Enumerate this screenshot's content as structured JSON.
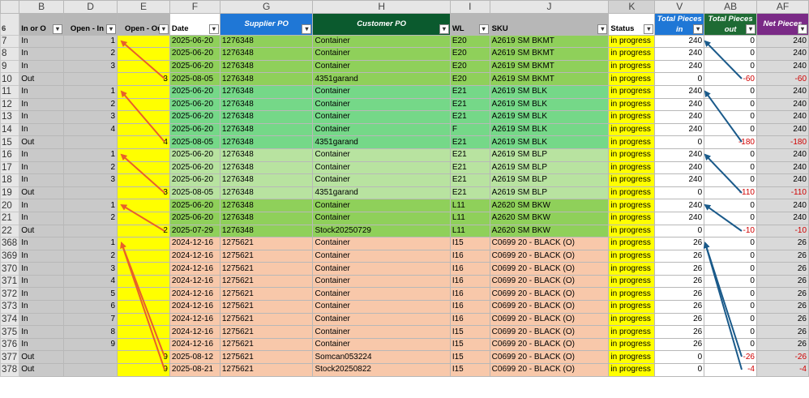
{
  "column_headers": [
    "B",
    "D",
    "E",
    "F",
    "G",
    "H",
    "I",
    "J",
    "K",
    "V",
    "AB",
    "AF"
  ],
  "selected_column": "K",
  "header_row": {
    "row_number": "6",
    "b": "In or O",
    "d": "Open - In",
    "e": "Open - Ou",
    "f": "Date",
    "g": "Supplier PO",
    "h": "Customer PO",
    "i": "WL",
    "j": "SKU",
    "k": "Status",
    "v": "Total Pieces in",
    "ab": "Total Pieces out",
    "af": "Net Pieces"
  },
  "colors": {
    "group_a": "#8fd05a",
    "group_b": "#75d888",
    "group_c": "#b8e3a0",
    "group_d": "#8fd05a",
    "group_e": "#f8c8aa",
    "yellow": "#ffff00",
    "arrow_orange": "#e8602a",
    "arrow_blue": "#1a5a8a"
  },
  "rows": [
    {
      "rn": "7",
      "b": "In",
      "d": "1",
      "e": "",
      "f": "2025-06-20",
      "g": "1276348",
      "h": "Container",
      "i": "E20",
      "j": "A2619 SM BKMT",
      "k": "in progress",
      "v": "240",
      "ab": "0",
      "af": "240",
      "grp": "g1"
    },
    {
      "rn": "8",
      "b": "In",
      "d": "2",
      "e": "",
      "f": "2025-06-20",
      "g": "1276348",
      "h": "Container",
      "i": "E20",
      "j": "A2619 SM BKMT",
      "k": "in progress",
      "v": "240",
      "ab": "0",
      "af": "240",
      "grp": "g1"
    },
    {
      "rn": "9",
      "b": "In",
      "d": "3",
      "e": "",
      "f": "2025-06-20",
      "g": "1276348",
      "h": "Container",
      "i": "E20",
      "j": "A2619 SM BKMT",
      "k": "in progress",
      "v": "240",
      "ab": "0",
      "af": "240",
      "grp": "g1"
    },
    {
      "rn": "10",
      "b": "Out",
      "d": "",
      "e": "3",
      "f": "2025-08-05",
      "g": "1276348",
      "h": "4351garand",
      "i": "E20",
      "j": "A2619 SM BKMT",
      "k": "in progress",
      "v": "0",
      "ab": "-60",
      "af": "-60",
      "grp": "g1"
    },
    {
      "rn": "11",
      "b": "In",
      "d": "1",
      "e": "",
      "f": "2025-06-20",
      "g": "1276348",
      "h": "Container",
      "i": "E21",
      "j": "A2619 SM BLK",
      "k": "in progress",
      "v": "240",
      "ab": "0",
      "af": "240",
      "grp": "g2"
    },
    {
      "rn": "12",
      "b": "In",
      "d": "2",
      "e": "",
      "f": "2025-06-20",
      "g": "1276348",
      "h": "Container",
      "i": "E21",
      "j": "A2619 SM BLK",
      "k": "in progress",
      "v": "240",
      "ab": "0",
      "af": "240",
      "grp": "g2"
    },
    {
      "rn": "13",
      "b": "In",
      "d": "3",
      "e": "",
      "f": "2025-06-20",
      "g": "1276348",
      "h": "Container",
      "i": "E21",
      "j": "A2619 SM BLK",
      "k": "in progress",
      "v": "240",
      "ab": "0",
      "af": "240",
      "grp": "g2"
    },
    {
      "rn": "14",
      "b": "In",
      "d": "4",
      "e": "",
      "f": "2025-06-20",
      "g": "1276348",
      "h": "Container",
      "i": "F",
      "j": "A2619 SM BLK",
      "k": "in progress",
      "v": "240",
      "ab": "0",
      "af": "240",
      "grp": "g2"
    },
    {
      "rn": "15",
      "b": "Out",
      "d": "",
      "e": "4",
      "f": "2025-08-05",
      "g": "1276348",
      "h": "4351garand",
      "i": "E21",
      "j": "A2619 SM BLK",
      "k": "in progress",
      "v": "0",
      "ab": "-180",
      "af": "-180",
      "grp": "g2"
    },
    {
      "rn": "16",
      "b": "In",
      "d": "1",
      "e": "",
      "f": "2025-06-20",
      "g": "1276348",
      "h": "Container",
      "i": "E21",
      "j": "A2619 SM BLP",
      "k": "in progress",
      "v": "240",
      "ab": "0",
      "af": "240",
      "grp": "g3"
    },
    {
      "rn": "17",
      "b": "In",
      "d": "2",
      "e": "",
      "f": "2025-06-20",
      "g": "1276348",
      "h": "Container",
      "i": "E21",
      "j": "A2619 SM BLP",
      "k": "in progress",
      "v": "240",
      "ab": "0",
      "af": "240",
      "grp": "g3"
    },
    {
      "rn": "18",
      "b": "In",
      "d": "3",
      "e": "",
      "f": "2025-06-20",
      "g": "1276348",
      "h": "Container",
      "i": "E21",
      "j": "A2619 SM BLP",
      "k": "in progress",
      "v": "240",
      "ab": "0",
      "af": "240",
      "grp": "g3"
    },
    {
      "rn": "19",
      "b": "Out",
      "d": "",
      "e": "3",
      "f": "2025-08-05",
      "g": "1276348",
      "h": "4351garand",
      "i": "E21",
      "j": "A2619 SM BLP",
      "k": "in progress",
      "v": "0",
      "ab": "-110",
      "af": "-110",
      "grp": "g3"
    },
    {
      "rn": "20",
      "b": "In",
      "d": "1",
      "e": "",
      "f": "2025-06-20",
      "g": "1276348",
      "h": "Container",
      "i": "L11",
      "j": "A2620 SM BKW",
      "k": "in progress",
      "v": "240",
      "ab": "0",
      "af": "240",
      "grp": "g4"
    },
    {
      "rn": "21",
      "b": "In",
      "d": "2",
      "e": "",
      "f": "2025-06-20",
      "g": "1276348",
      "h": "Container",
      "i": "L11",
      "j": "A2620 SM BKW",
      "k": "in progress",
      "v": "240",
      "ab": "0",
      "af": "240",
      "grp": "g4"
    },
    {
      "rn": "22",
      "b": "Out",
      "d": "",
      "e": "2",
      "f": "2025-07-29",
      "g": "1276348",
      "h": "Stock20250729",
      "i": "L11",
      "j": "A2620 SM BKW",
      "k": "in progress",
      "v": "0",
      "ab": "-10",
      "af": "-10",
      "grp": "g4"
    },
    {
      "rn": "368",
      "b": "In",
      "d": "1",
      "e": "",
      "f": "2024-12-16",
      "g": "1275621",
      "h": "Container",
      "i": "I15",
      "j": "C0699 20 - BLACK (O)",
      "k": "in progress",
      "v": "26",
      "ab": "0",
      "af": "26",
      "grp": "pk"
    },
    {
      "rn": "369",
      "b": "In",
      "d": "2",
      "e": "",
      "f": "2024-12-16",
      "g": "1275621",
      "h": "Container",
      "i": "I16",
      "j": "C0699 20 - BLACK (O)",
      "k": "in progress",
      "v": "26",
      "ab": "0",
      "af": "26",
      "grp": "pk"
    },
    {
      "rn": "370",
      "b": "In",
      "d": "3",
      "e": "",
      "f": "2024-12-16",
      "g": "1275621",
      "h": "Container",
      "i": "I16",
      "j": "C0699 20 - BLACK (O)",
      "k": "in progress",
      "v": "26",
      "ab": "0",
      "af": "26",
      "grp": "pk"
    },
    {
      "rn": "371",
      "b": "In",
      "d": "4",
      "e": "",
      "f": "2024-12-16",
      "g": "1275621",
      "h": "Container",
      "i": "I16",
      "j": "C0699 20 - BLACK (O)",
      "k": "in progress",
      "v": "26",
      "ab": "0",
      "af": "26",
      "grp": "pk"
    },
    {
      "rn": "372",
      "b": "In",
      "d": "5",
      "e": "",
      "f": "2024-12-16",
      "g": "1275621",
      "h": "Container",
      "i": "I16",
      "j": "C0699 20 - BLACK (O)",
      "k": "in progress",
      "v": "26",
      "ab": "0",
      "af": "26",
      "grp": "pk"
    },
    {
      "rn": "373",
      "b": "In",
      "d": "6",
      "e": "",
      "f": "2024-12-16",
      "g": "1275621",
      "h": "Container",
      "i": "I16",
      "j": "C0699 20 - BLACK (O)",
      "k": "in progress",
      "v": "26",
      "ab": "0",
      "af": "26",
      "grp": "pk"
    },
    {
      "rn": "374",
      "b": "In",
      "d": "7",
      "e": "",
      "f": "2024-12-16",
      "g": "1275621",
      "h": "Container",
      "i": "I16",
      "j": "C0699 20 - BLACK (O)",
      "k": "in progress",
      "v": "26",
      "ab": "0",
      "af": "26",
      "grp": "pk"
    },
    {
      "rn": "375",
      "b": "In",
      "d": "8",
      "e": "",
      "f": "2024-12-16",
      "g": "1275621",
      "h": "Container",
      "i": "I15",
      "j": "C0699 20 - BLACK (O)",
      "k": "in progress",
      "v": "26",
      "ab": "0",
      "af": "26",
      "grp": "pk"
    },
    {
      "rn": "376",
      "b": "In",
      "d": "9",
      "e": "",
      "f": "2024-12-16",
      "g": "1275621",
      "h": "Container",
      "i": "I15",
      "j": "C0699 20 - BLACK (O)",
      "k": "in progress",
      "v": "26",
      "ab": "0",
      "af": "26",
      "grp": "pk"
    },
    {
      "rn": "377",
      "b": "Out",
      "d": "",
      "e": "9",
      "f": "2025-08-12",
      "g": "1275621",
      "h": "Somcan053224",
      "i": "I15",
      "j": "C0699 20 - BLACK (O)",
      "k": "in progress",
      "v": "0",
      "ab": "-26",
      "af": "-26",
      "grp": "pk"
    },
    {
      "rn": "378",
      "b": "Out",
      "d": "",
      "e": "9",
      "f": "2025-08-21",
      "g": "1275621",
      "h": "Stock20250822",
      "i": "I15",
      "j": "C0699 20 - BLACK (O)",
      "k": "in progress",
      "v": "0",
      "ab": "-4",
      "af": "-4",
      "grp": "pk"
    }
  ]
}
